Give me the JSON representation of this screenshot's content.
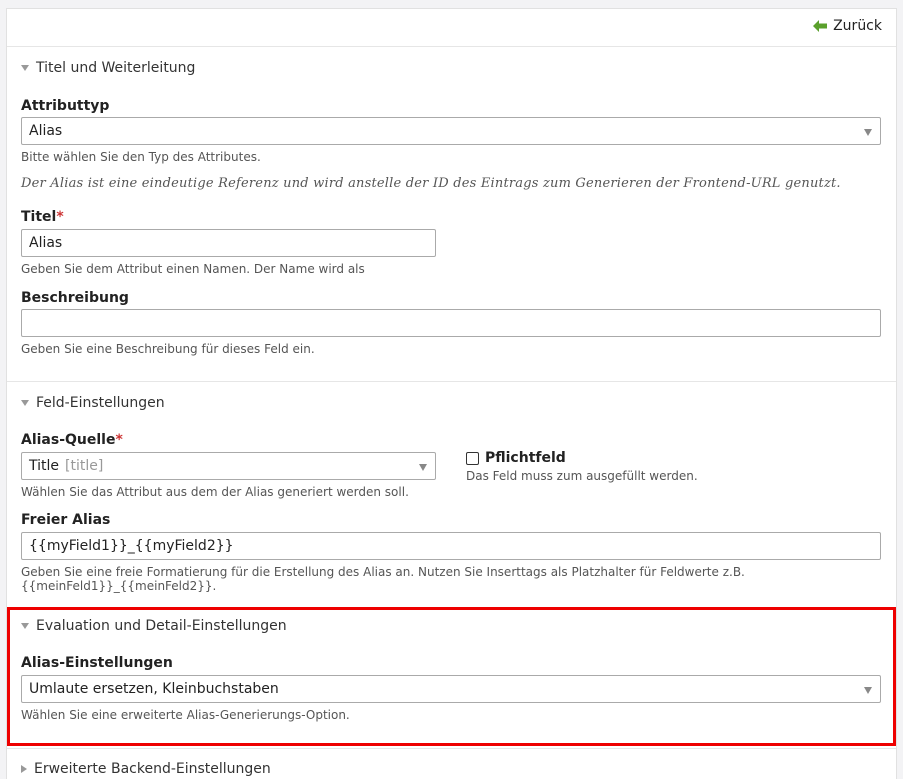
{
  "header": {
    "back_label": "Zurück"
  },
  "sections": {
    "titel": {
      "legend": "Titel und Weiterleitung",
      "attributtyp": {
        "label": "Attributtyp",
        "value": "Alias",
        "help": "Bitte wählen Sie den Typ des Attributes."
      },
      "note": "Der Alias ist eine eindeutige Referenz und wird anstelle der ID des Eintrags zum Generieren der Frontend-URL genutzt.",
      "titel": {
        "label": "Titel",
        "required": "*",
        "value": "Alias",
        "help": "Geben Sie dem Attribut einen Namen. Der Name wird als"
      },
      "beschreibung": {
        "label": "Beschreibung",
        "value": "",
        "help": "Geben Sie eine Beschreibung für dieses Feld ein."
      }
    },
    "feld": {
      "legend": "Feld-Einstellungen",
      "alias_quelle": {
        "label": "Alias-Quelle",
        "required": "*",
        "value": "Title",
        "hint": "[title]",
        "help": "Wählen Sie das Attribut aus dem der Alias generiert werden soll."
      },
      "pflichtfeld": {
        "label": "Pflichtfeld",
        "help": "Das Feld muss zum ausgefüllt werden.",
        "checked": false
      },
      "freier_alias": {
        "label": "Freier Alias",
        "value": "{{myField1}}_{{myField2}}",
        "help": "Geben Sie eine freie Formatierung für die Erstellung des Alias an. Nutzen Sie Inserttags als Platzhalter für Feldwerte z.B. {{meinFeld1}}_{{meinFeld2}}."
      }
    },
    "evaluation": {
      "legend": "Evaluation und Detail-Einstellungen",
      "alias_einstellungen": {
        "label": "Alias-Einstellungen",
        "value": "Umlaute ersetzen, Kleinbuchstaben",
        "help": "Wählen Sie eine erweiterte Alias-Generierungs-Option."
      }
    },
    "backend": {
      "legend": "Erweiterte Backend-Einstellungen"
    }
  },
  "colors": {
    "highlight": "#ee0000",
    "back_arrow": "#5aa02c",
    "required": "#cc3333"
  }
}
